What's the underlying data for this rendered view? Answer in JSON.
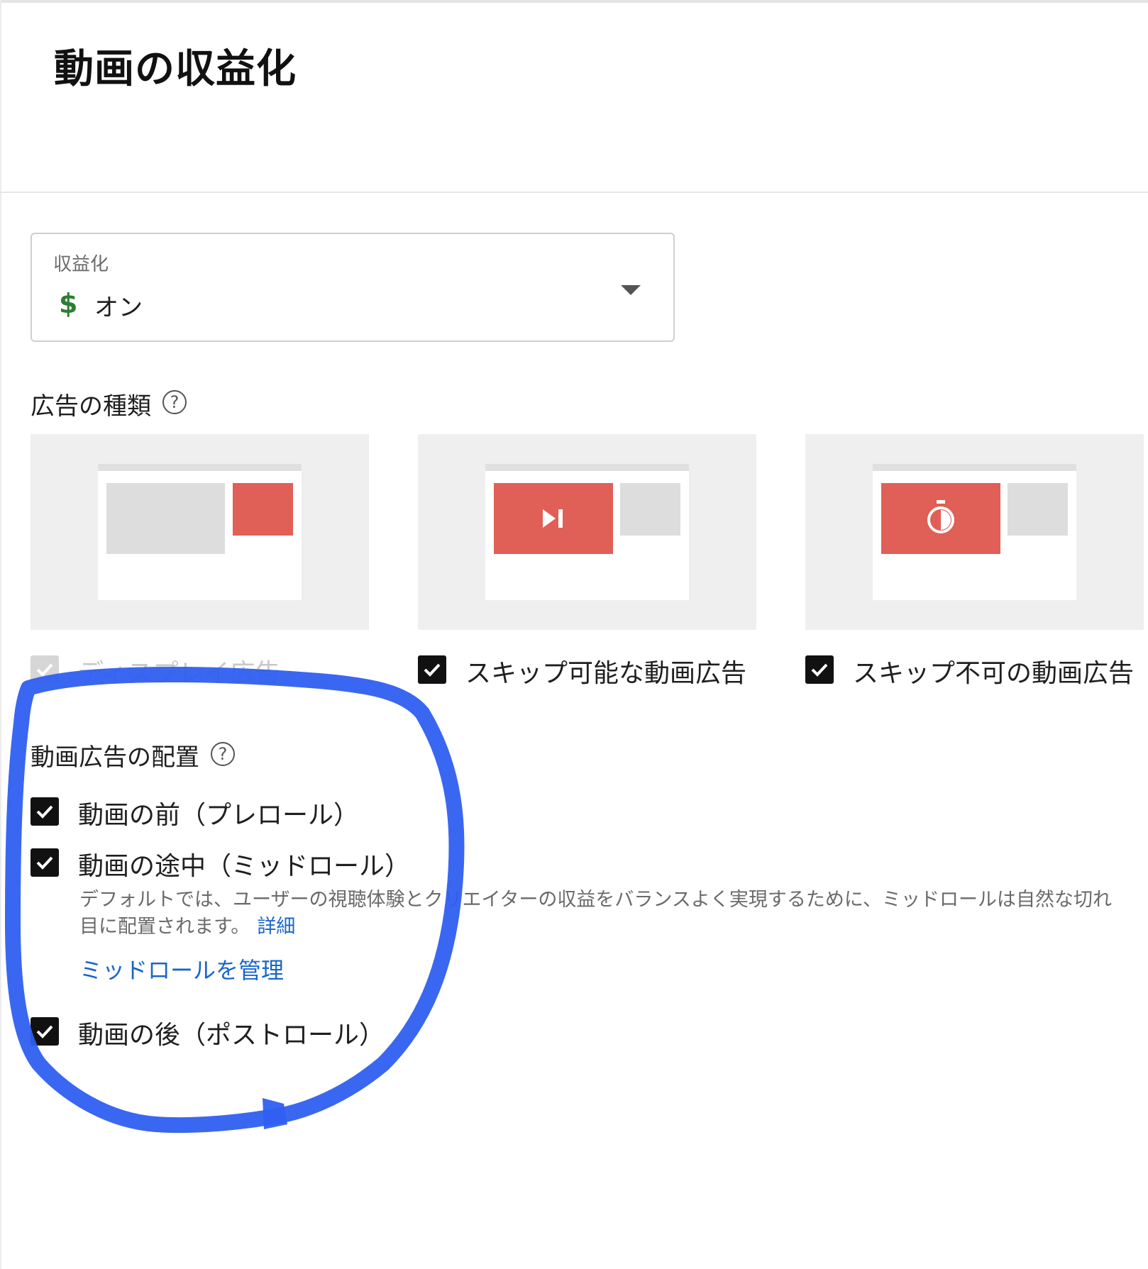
{
  "page": {
    "title": "動画の収益化"
  },
  "monetization": {
    "label": "収益化",
    "value": "オン",
    "icon": "dollar-icon",
    "icon_glyph": "$",
    "icon_color": "#2e7d32"
  },
  "ad_types": {
    "label": "広告の種類",
    "help": "?",
    "items": [
      {
        "label": "ディスプレイ広告",
        "checked": true,
        "disabled": true
      },
      {
        "label": "スキップ可能な動画広告",
        "checked": true,
        "disabled": false,
        "icon": "skip-icon"
      },
      {
        "label": "スキップ不可の動画広告",
        "checked": true,
        "disabled": false,
        "icon": "timer-icon"
      }
    ]
  },
  "placement": {
    "label": "動画広告の配置",
    "help": "?",
    "items": [
      {
        "label": "動画の前（プレロール）",
        "checked": true
      },
      {
        "label": "動画の途中（ミッドロール）",
        "checked": true
      },
      {
        "label": "動画の後（ポストロール）",
        "checked": true
      }
    ],
    "mid_description": "デフォルトでは、ユーザーの視聴体験とクリエイターの収益をバランスよく実現するために、ミッドロールは自然な切れ目に配置されます。",
    "details_link": "詳細",
    "manage_link": "ミッドロールを管理"
  },
  "colors": {
    "accent_link": "#1a66c9",
    "ad_red": "#e05f56",
    "annotation_blue": "#2f5ff0"
  }
}
